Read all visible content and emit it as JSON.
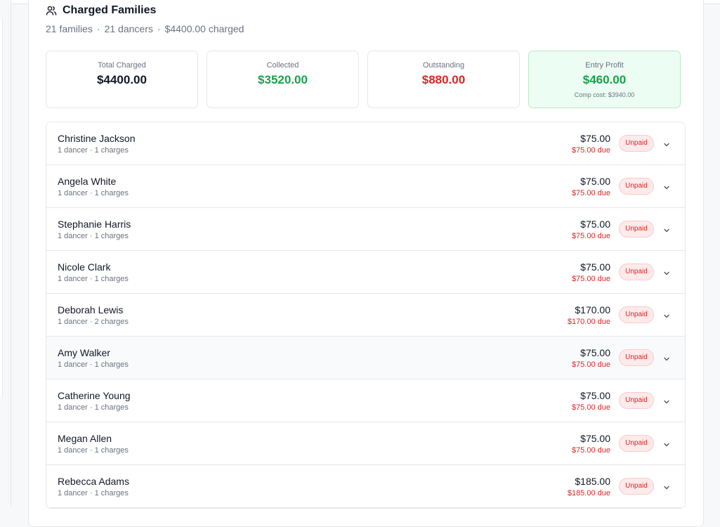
{
  "header": {
    "title": "Charged Families",
    "families": "21 families",
    "dancers": "21 dancers",
    "charged": "$4400.00 charged",
    "sep": "·"
  },
  "stats": [
    {
      "label": "Total Charged",
      "value": "$4400.00",
      "sub": ""
    },
    {
      "label": "Collected",
      "value": "$3520.00",
      "sub": ""
    },
    {
      "label": "Outstanding",
      "value": "$880.00",
      "sub": ""
    },
    {
      "label": "Entry Profit",
      "value": "$460.00",
      "sub": "Comp cost: $3940.00"
    }
  ],
  "families": [
    {
      "name": "Christine Jackson",
      "meta": "1 dancer · 1 charges",
      "amount": "$75.00",
      "due": "$75.00 due",
      "status": "Unpaid"
    },
    {
      "name": "Angela White",
      "meta": "1 dancer · 1 charges",
      "amount": "$75.00",
      "due": "$75.00 due",
      "status": "Unpaid"
    },
    {
      "name": "Stephanie Harris",
      "meta": "1 dancer · 1 charges",
      "amount": "$75.00",
      "due": "$75.00 due",
      "status": "Unpaid"
    },
    {
      "name": "Nicole Clark",
      "meta": "1 dancer · 1 charges",
      "amount": "$75.00",
      "due": "$75.00 due",
      "status": "Unpaid"
    },
    {
      "name": "Deborah Lewis",
      "meta": "1 dancer · 2 charges",
      "amount": "$170.00",
      "due": "$170.00 due",
      "status": "Unpaid"
    },
    {
      "name": "Amy Walker",
      "meta": "1 dancer · 1 charges",
      "amount": "$75.00",
      "due": "$75.00 due",
      "status": "Unpaid"
    },
    {
      "name": "Catherine Young",
      "meta": "1 dancer · 1 charges",
      "amount": "$75.00",
      "due": "$75.00 due",
      "status": "Unpaid"
    },
    {
      "name": "Megan Allen",
      "meta": "1 dancer · 1 charges",
      "amount": "$75.00",
      "due": "$75.00 due",
      "status": "Unpaid"
    },
    {
      "name": "Rebecca Adams",
      "meta": "1 dancer · 1 charges",
      "amount": "$185.00",
      "due": "$185.00 due",
      "status": "Unpaid"
    }
  ],
  "icons": {
    "header": "users-icon",
    "row": "chevron-down-icon"
  },
  "colors": {
    "collected": "#16a34a",
    "outstanding": "#dc2626",
    "profit_bg": "#ecfdf3",
    "unpaid": "#dc2626"
  }
}
